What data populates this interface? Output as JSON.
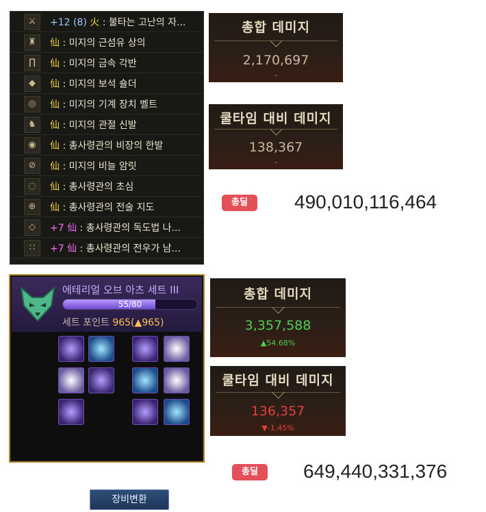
{
  "equipment": [
    {
      "refine": "+12 (8)",
      "mark": "火",
      "name": " : 불타는 고난의 자...",
      "refine_color": "blue"
    },
    {
      "refine": "",
      "mark": "仙",
      "name": " : 미지의 근섬유 상의",
      "refine_color": ""
    },
    {
      "refine": "",
      "mark": "仙",
      "name": " : 미지의 금속 각반",
      "refine_color": ""
    },
    {
      "refine": "",
      "mark": "仙",
      "name": " : 미지의 보석 숄더",
      "refine_color": ""
    },
    {
      "refine": "",
      "mark": "仙",
      "name": " : 미지의 기계 장치 벨트",
      "refine_color": ""
    },
    {
      "refine": "",
      "mark": "仙",
      "name": " : 미지의 관절 신발",
      "refine_color": ""
    },
    {
      "refine": "",
      "mark": "仙",
      "name": " : 총사령관의 비장의 한발",
      "refine_color": ""
    },
    {
      "refine": "",
      "mark": "仙",
      "name": " : 미지의 비늘 암릿",
      "refine_color": ""
    },
    {
      "refine": "",
      "mark": "仙",
      "name": " : 총사령관의 초심",
      "refine_color": ""
    },
    {
      "refine": "",
      "mark": "仙",
      "name": " : 총사령관의 전술 지도",
      "refine_color": ""
    },
    {
      "refine": "+7",
      "mark": "仙",
      "name": " : 총사령관의 독도법 나...",
      "refine_color": "pink"
    },
    {
      "refine": "+7",
      "mark": "仙",
      "name": " : 총사령관의 전우가 남...",
      "refine_color": "pink"
    }
  ],
  "before": {
    "total_damage": {
      "title": "총합 데미지",
      "value": "2,170,697",
      "sub": "-"
    },
    "cooltime_damage": {
      "title": "쿨타임 대비 데미지",
      "value": "138,367",
      "sub": "-"
    },
    "total_deal": {
      "badge": "총딜",
      "value": "490,010,116,464"
    }
  },
  "set": {
    "name": "에테리얼 오브 아츠 세트 III",
    "progress_text": "55/80",
    "progress_fraction": 0.6875,
    "points_label": "세트 포인트 ",
    "points_value": "965",
    "points_delta": "(▲965)",
    "swap_button": "장비변환",
    "slots": [
      {
        "style": "purple"
      },
      {
        "style": "blue"
      },
      {
        "style": "purple"
      },
      {
        "style": "white"
      },
      {
        "style": "white"
      },
      {
        "style": "purple"
      },
      {
        "style": "blue"
      },
      {
        "style": "white"
      },
      {
        "style": "purple"
      },
      {
        "style": "purple"
      },
      {
        "style": "blue"
      }
    ]
  },
  "after": {
    "total_damage": {
      "title": "총합 데미지",
      "value": "3,357,588",
      "sub": "▲54.68%"
    },
    "cooltime_damage": {
      "title": "쿨타임 대비 데미지",
      "value": "136,357",
      "sub": "▼-1.45%"
    },
    "total_deal": {
      "badge": "총딜",
      "value": "649,440,331,376"
    }
  },
  "colors": {
    "badge": "#e4505a",
    "increase": "#4fcf58",
    "decrease": "#e04040",
    "set_border": "#b08a2a"
  }
}
